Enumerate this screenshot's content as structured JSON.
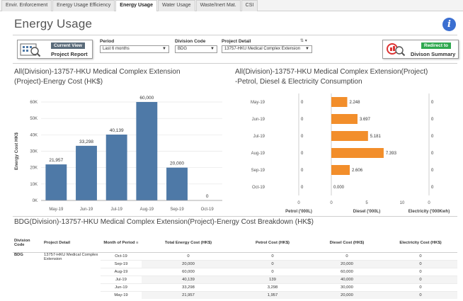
{
  "tabs": [
    {
      "label": "Envir. Enforcement",
      "active": false
    },
    {
      "label": "Energy Usage Efficiency",
      "active": false
    },
    {
      "label": "Energy Usage",
      "active": true
    },
    {
      "label": "Water Usage",
      "active": false
    },
    {
      "label": "Waste/Inert Mat.",
      "active": false
    },
    {
      "label": "CSI",
      "active": false
    }
  ],
  "page": {
    "title": "Energy Usage",
    "info_icon": "i"
  },
  "buttons": {
    "current_view": {
      "tag": "Current View",
      "label": "Project Report"
    },
    "redirect": {
      "tag": "Redirect to",
      "label": "Divison Summary"
    }
  },
  "filters": {
    "period": {
      "label": "Period",
      "value": "Last 6 months"
    },
    "division": {
      "label": "Division Code",
      "value": "BDG"
    },
    "project": {
      "label": "Project Detail",
      "value": "13757-HKU Medical Complex Extension"
    }
  },
  "colors": {
    "bar_blue": "#4e79a7",
    "bar_orange": "#f28e2b",
    "info_blue": "#3b6fd1",
    "redirect_green": "#2fa84f"
  },
  "chart_left_title": {
    "line1": "All(Division)-13757-HKU Medical Complex Extension",
    "line2": "(Project)-Energy Cost (HK$)"
  },
  "chart_right_title": {
    "line1": "All(Division)-13757-HKU Medical Complex Extension(Project)",
    "line2": "-Petrol, Diesel & Electricity Consumption"
  },
  "chart_data": [
    {
      "type": "bar",
      "categories": [
        "May-19",
        "Jun-19",
        "Jul-19",
        "Aug-19",
        "Sep-19",
        "Oct-19"
      ],
      "values": [
        21957,
        33298,
        40139,
        60000,
        20000,
        0
      ],
      "data_labels": [
        "21,957",
        "33,298",
        "40,139",
        "60,000",
        "20,000",
        "0"
      ],
      "ylabel": "Energy Cost HK$",
      "ylim": [
        0,
        60000
      ],
      "yticks": [
        0,
        10000,
        20000,
        30000,
        40000,
        50000,
        60000
      ],
      "ytick_labels": [
        "0K",
        "10K",
        "20K",
        "30K",
        "40K",
        "50K",
        "60K"
      ],
      "grid": true
    },
    {
      "type": "bar",
      "orientation": "horizontal",
      "categories": [
        "May-19",
        "Jun-19",
        "Jul-19",
        "Aug-19",
        "Sep-19",
        "Oct-19"
      ],
      "series": [
        {
          "name": "Petrol ('000L)",
          "values": [
            0,
            0,
            0,
            0,
            0,
            0
          ],
          "labels": [
            "0",
            "0",
            "0",
            "0",
            "0",
            "0"
          ],
          "xticks": [
            "0"
          ]
        },
        {
          "name": "Diesel ('000L)",
          "values": [
            2.248,
            3.697,
            5.181,
            7.393,
            2.606,
            0
          ],
          "labels": [
            "2.248",
            "3.697",
            "5.181",
            "7.393",
            "2.606",
            "0.000"
          ],
          "xlim": [
            0,
            10
          ],
          "xticks": [
            "0",
            "5",
            "10"
          ]
        },
        {
          "name": "Electricity ('000Kwh)",
          "values": [
            0,
            0,
            0,
            0,
            0,
            0
          ],
          "labels": [
            "0",
            "0",
            "0",
            "0",
            "0",
            "0"
          ],
          "xticks": [
            "0"
          ]
        }
      ]
    }
  ],
  "breakdown": {
    "title": "BDG(Division)-13757-HKU Medical Complex Extension(Project)-Energy Cost Breakdown (HK$)",
    "headers": [
      "Division Code",
      "Project Detail",
      "Month of Period",
      "Total Energy Cost (HK$)",
      "Petrol Cost (HK$)",
      "Diesel Cost (HK$)",
      "Electricity Cost (HK$)"
    ],
    "division": "BDG",
    "project": "13757-HKU Medical Complex Extension",
    "rows": [
      {
        "month": "Oct-19",
        "total": "0",
        "petrol": "0",
        "diesel": "0",
        "electricity": "0"
      },
      {
        "month": "Sep-19",
        "total": "20,000",
        "petrol": "0",
        "diesel": "20,000",
        "electricity": "0"
      },
      {
        "month": "Aug-19",
        "total": "60,000",
        "petrol": "0",
        "diesel": "60,000",
        "electricity": "0"
      },
      {
        "month": "Jul-19",
        "total": "40,139",
        "petrol": "139",
        "diesel": "40,000",
        "electricity": "0"
      },
      {
        "month": "Jun-19",
        "total": "33,298",
        "petrol": "3,298",
        "diesel": "30,000",
        "electricity": "0"
      },
      {
        "month": "May-19",
        "total": "21,957",
        "petrol": "1,957",
        "diesel": "20,000",
        "electricity": "0"
      }
    ]
  }
}
